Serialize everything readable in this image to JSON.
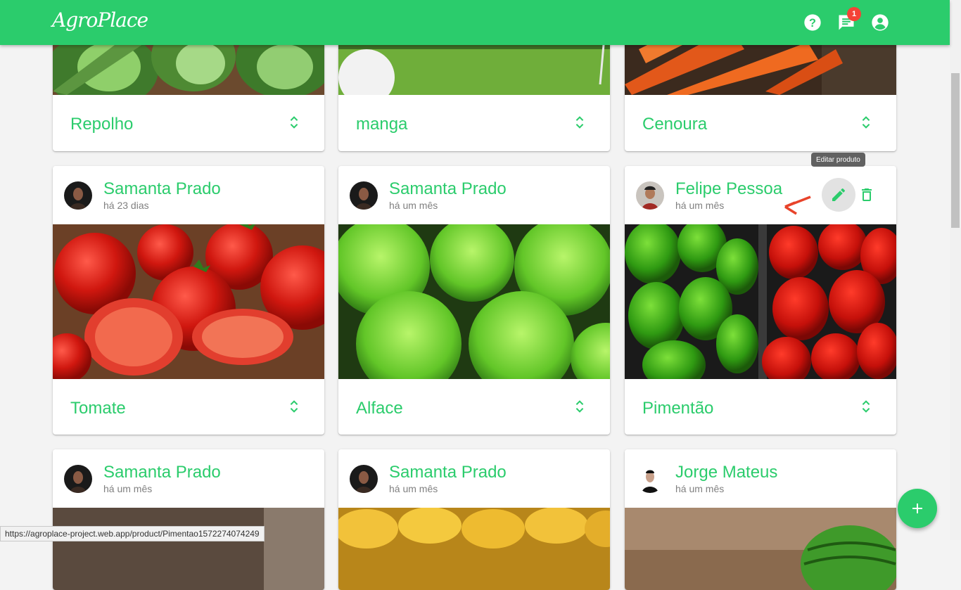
{
  "app": {
    "logo": "AgroPlace",
    "notifications_count": "1"
  },
  "colors": {
    "brand": "#2bcc6c",
    "badge": "#f44336"
  },
  "icons": {
    "help": "help-icon",
    "messages": "chat-icon",
    "account": "account-circle-icon",
    "expand": "unfold-more-icon",
    "edit": "pencil-icon",
    "delete": "trash-icon",
    "add": "plus-icon"
  },
  "row1": [
    {
      "product": "Repolho"
    },
    {
      "product": "manga"
    },
    {
      "product": "Cenoura"
    }
  ],
  "row2": [
    {
      "author": "Samanta Prado",
      "date": "há 23 dias",
      "product": "Tomate"
    },
    {
      "author": "Samanta Prado",
      "date": "há um mês",
      "product": "Alface"
    },
    {
      "author": "Felipe Pessoa",
      "date": "há um mês",
      "product": "Pimentão"
    }
  ],
  "row3": [
    {
      "author": "Samanta Prado",
      "date": "há um mês"
    },
    {
      "author": "Samanta Prado",
      "date": "há um mês"
    },
    {
      "author": "Jorge Mateus",
      "date": "há um mês"
    }
  ],
  "tooltip": "Editar produto",
  "status_url": "https://agroplace-project.web.app/product/Pimentao1572274074249"
}
